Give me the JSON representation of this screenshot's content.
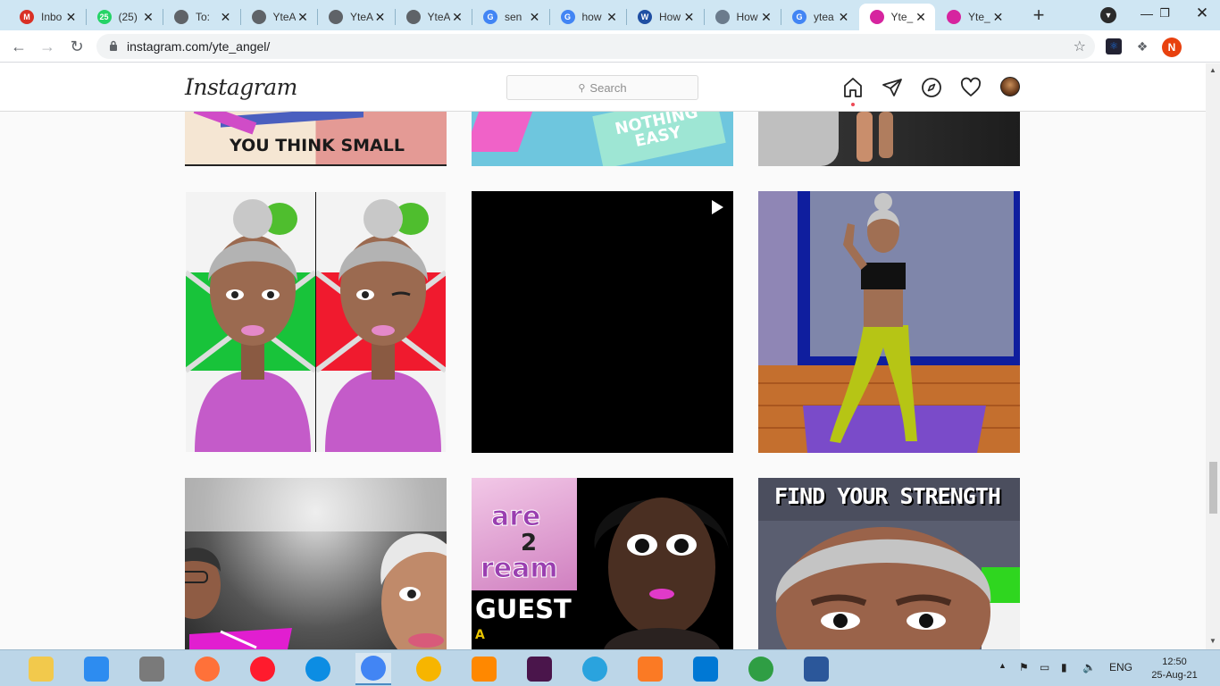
{
  "browser": {
    "tabs": [
      {
        "title": "Inbo",
        "icon": "gmail-icon",
        "color": "#d93025",
        "glyph": "M",
        "active": false
      },
      {
        "title": "(25)",
        "icon": "whatsapp-icon",
        "color": "#25d366",
        "glyph": "25",
        "active": false
      },
      {
        "title": "To:",
        "icon": "globe-icon",
        "color": "#5f6368",
        "glyph": "",
        "active": false
      },
      {
        "title": "YteA",
        "icon": "globe-icon",
        "color": "#5f6368",
        "glyph": "",
        "active": false
      },
      {
        "title": "YteA",
        "icon": "globe-icon",
        "color": "#5f6368",
        "glyph": "",
        "active": false
      },
      {
        "title": "YteA",
        "icon": "globe-icon",
        "color": "#5f6368",
        "glyph": "",
        "active": false
      },
      {
        "title": "sen",
        "icon": "google-icon",
        "color": "#4285f4",
        "glyph": "G",
        "active": false
      },
      {
        "title": "how",
        "icon": "google-icon",
        "color": "#4285f4",
        "glyph": "G",
        "active": false
      },
      {
        "title": "How",
        "icon": "wikihow-icon",
        "color": "#1f4fa3",
        "glyph": "W",
        "active": false
      },
      {
        "title": "How",
        "icon": "page-thumbnail-icon",
        "color": "#6b7b8c",
        "glyph": "",
        "active": false
      },
      {
        "title": "ytea",
        "icon": "google-icon",
        "color": "#4285f4",
        "glyph": "G",
        "active": false
      },
      {
        "title": "Yte_",
        "icon": "instagram-icon",
        "color": "#d6249f",
        "glyph": "",
        "active": true
      },
      {
        "title": "Yte_",
        "icon": "instagram-icon",
        "color": "#d6249f",
        "glyph": "",
        "active": false
      }
    ],
    "url": "instagram.com/yte_angel/",
    "profile_initial": "N",
    "profile_color": "#e8410f"
  },
  "instagram": {
    "logo": "Instagram",
    "search_placeholder": "Search",
    "nav_icons": [
      "home-icon",
      "direct-message-icon",
      "explore-icon",
      "activity-heart-icon",
      "profile-avatar"
    ]
  },
  "grid": {
    "row1": [
      {
        "caption": "YOU THINK SMALL"
      },
      {
        "caption": "NOTHING EASY"
      },
      {
        "caption": ""
      }
    ],
    "row2": [
      {
        "caption": "",
        "type": "image"
      },
      {
        "caption": "",
        "type": "video"
      },
      {
        "caption": "",
        "type": "image"
      }
    ],
    "row3": [
      {
        "caption": "",
        "type": "image"
      },
      {
        "caption_a": "are",
        "caption_b": "2",
        "caption_c": "ream",
        "caption_d": "GUEST",
        "caption_e": "A",
        "type": "image"
      },
      {
        "caption": "FIND YOUR STRENGTH",
        "type": "image"
      }
    ]
  },
  "taskbar": {
    "apps": [
      {
        "name": "file-explorer-icon",
        "color": "#f2c94c"
      },
      {
        "name": "media-player-icon",
        "color": "#2d8cf0"
      },
      {
        "name": "archive-app-icon",
        "color": "#7a7a7a"
      },
      {
        "name": "firefox-icon",
        "color": "#ff7139"
      },
      {
        "name": "opera-icon",
        "color": "#ff1b2d"
      },
      {
        "name": "edge-icon",
        "color": "#0c8de3"
      },
      {
        "name": "chrome-icon",
        "color": "#4285f4"
      },
      {
        "name": "chrome-canary-icon",
        "color": "#f7b500"
      },
      {
        "name": "vlc-icon",
        "color": "#ff8800"
      },
      {
        "name": "slack-icon",
        "color": "#4a154b"
      },
      {
        "name": "telegram-icon",
        "color": "#2aa3de"
      },
      {
        "name": "xampp-icon",
        "color": "#fb7a24"
      },
      {
        "name": "vscode-icon",
        "color": "#0078d4"
      },
      {
        "name": "hotspot-icon",
        "color": "#2f9e44"
      },
      {
        "name": "word-icon",
        "color": "#2b579a"
      }
    ],
    "lang": "ENG",
    "time": "12:50",
    "date": "25-Aug-21"
  }
}
